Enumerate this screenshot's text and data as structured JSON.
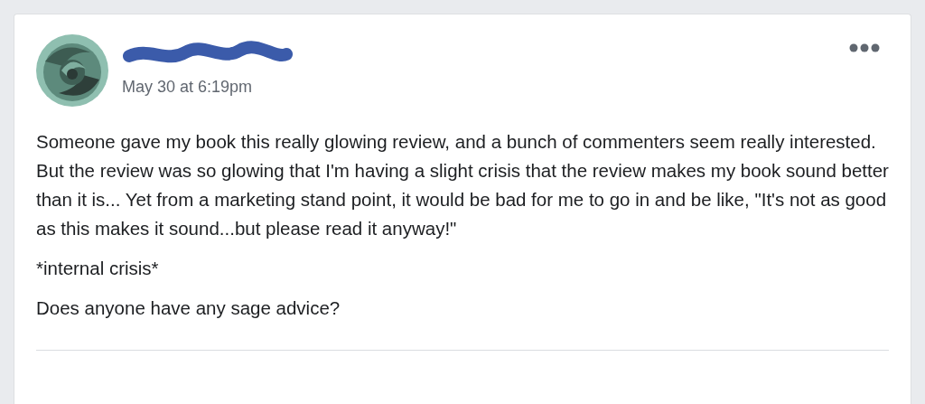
{
  "post": {
    "author": {
      "redacted": true
    },
    "timestamp": "May 30 at 6:19pm",
    "paragraphs": [
      "Someone gave my book this really glowing review, and a bunch of commenters seem really interested. But the review was so glowing that I'm having a slight crisis that the review makes my book sound better than it is... Yet from a marketing stand point, it would be bad for me to go in and be like, \"It's not as good as this makes it sound...but please read it anyway!\"",
      "*internal crisis*",
      "Does anyone have any sage advice?"
    ]
  }
}
